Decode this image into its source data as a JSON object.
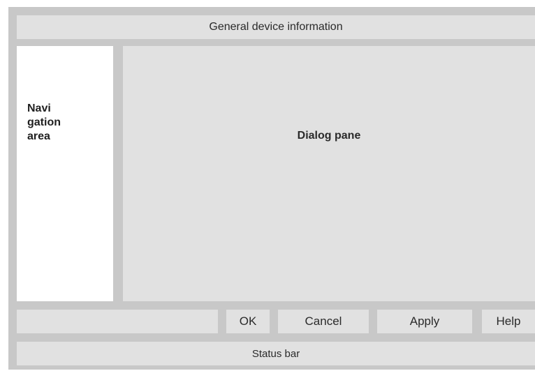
{
  "header": {
    "title": "General device information"
  },
  "navigation": {
    "label": "Navi\ngation\narea"
  },
  "dialog": {
    "label": "Dialog pane"
  },
  "buttons": {
    "ok": "OK",
    "cancel": "Cancel",
    "apply": "Apply",
    "help": "Help"
  },
  "status_bar": {
    "label": "Status bar"
  },
  "colors": {
    "frame": "#c8c8c8",
    "panel": "#e1e1e1",
    "navigation_background": "#ffffff"
  }
}
